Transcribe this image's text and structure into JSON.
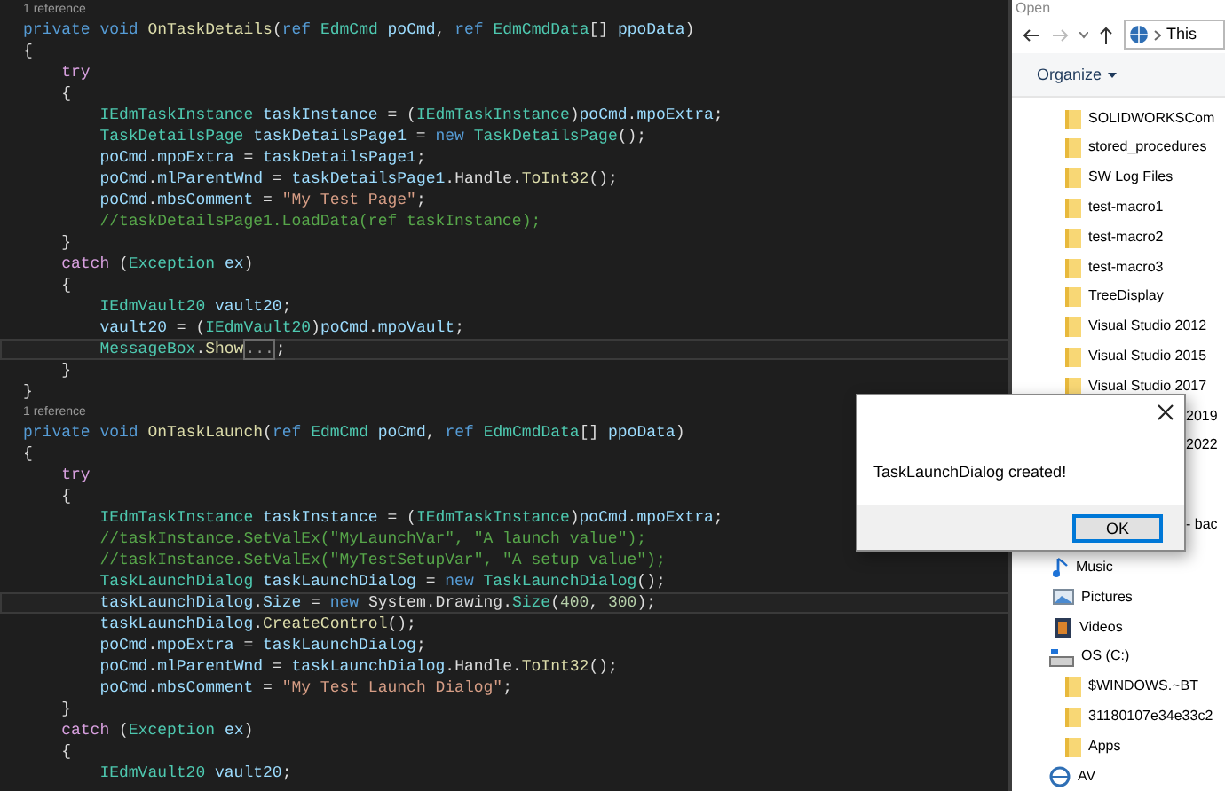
{
  "editor": {
    "lines": [
      {
        "kind": "reference",
        "text": "1 reference"
      },
      {
        "kind": "code",
        "highlighted": false,
        "tokens": [
          {
            "text": "private ",
            "kind": "keyword"
          },
          {
            "text": "void ",
            "kind": "keyword"
          },
          {
            "text": "OnTaskDetails",
            "kind": "method"
          },
          {
            "text": "(",
            "kind": "plain"
          },
          {
            "text": "ref ",
            "kind": "keyword"
          },
          {
            "text": "EdmCmd ",
            "kind": "type"
          },
          {
            "text": "poCmd",
            "kind": "variable"
          },
          {
            "text": ", ",
            "kind": "plain"
          },
          {
            "text": "ref ",
            "kind": "keyword"
          },
          {
            "text": "EdmCmdData",
            "kind": "type"
          },
          {
            "text": "[] ",
            "kind": "plain"
          },
          {
            "text": "ppoData",
            "kind": "variable"
          },
          {
            "text": ")",
            "kind": "plain"
          }
        ]
      },
      {
        "kind": "code",
        "highlighted": false,
        "tokens": [
          {
            "text": "{",
            "kind": "plain"
          }
        ]
      },
      {
        "kind": "code",
        "highlighted": false,
        "tokens": [
          {
            "text": "    try",
            "kind": "control"
          }
        ]
      },
      {
        "kind": "code",
        "highlighted": false,
        "tokens": [
          {
            "text": "    {",
            "kind": "plain"
          }
        ]
      },
      {
        "kind": "code",
        "highlighted": false,
        "tokens": [
          {
            "text": "        IEdmTaskInstance ",
            "kind": "type"
          },
          {
            "text": "taskInstance",
            "kind": "variable"
          },
          {
            "text": " = (",
            "kind": "plain"
          },
          {
            "text": "IEdmTaskInstance",
            "kind": "type"
          },
          {
            "text": ")",
            "kind": "plain"
          },
          {
            "text": "poCmd",
            "kind": "variable"
          },
          {
            "text": ".",
            "kind": "plain"
          },
          {
            "text": "mpoExtra",
            "kind": "variable"
          },
          {
            "text": ";",
            "kind": "plain"
          }
        ]
      },
      {
        "kind": "code",
        "highlighted": false,
        "tokens": [
          {
            "text": "        TaskDetailsPage ",
            "kind": "type"
          },
          {
            "text": "taskDetailsPage1",
            "kind": "variable"
          },
          {
            "text": " = ",
            "kind": "plain"
          },
          {
            "text": "new ",
            "kind": "keyword"
          },
          {
            "text": "TaskDetailsPage",
            "kind": "type"
          },
          {
            "text": "();",
            "kind": "plain"
          }
        ]
      },
      {
        "kind": "code",
        "highlighted": false,
        "tokens": [
          {
            "text": "        poCmd",
            "kind": "variable"
          },
          {
            "text": ".",
            "kind": "plain"
          },
          {
            "text": "mpoExtra",
            "kind": "variable"
          },
          {
            "text": " = ",
            "kind": "plain"
          },
          {
            "text": "taskDetailsPage1",
            "kind": "variable"
          },
          {
            "text": ";",
            "kind": "plain"
          }
        ]
      },
      {
        "kind": "code",
        "highlighted": false,
        "tokens": [
          {
            "text": "        poCmd",
            "kind": "variable"
          },
          {
            "text": ".",
            "kind": "plain"
          },
          {
            "text": "mlParentWnd",
            "kind": "variable"
          },
          {
            "text": " = ",
            "kind": "plain"
          },
          {
            "text": "taskDetailsPage1",
            "kind": "variable"
          },
          {
            "text": ".",
            "kind": "plain"
          },
          {
            "text": "Handle",
            "kind": "plain"
          },
          {
            "text": ".",
            "kind": "plain"
          },
          {
            "text": "ToInt32",
            "kind": "method"
          },
          {
            "text": "();",
            "kind": "plain"
          }
        ]
      },
      {
        "kind": "code",
        "highlighted": false,
        "tokens": [
          {
            "text": "        poCmd",
            "kind": "variable"
          },
          {
            "text": ".",
            "kind": "plain"
          },
          {
            "text": "mbsComment",
            "kind": "variable"
          },
          {
            "text": " = ",
            "kind": "plain"
          },
          {
            "text": "\"My Test Page\"",
            "kind": "string"
          },
          {
            "text": ";",
            "kind": "plain"
          }
        ]
      },
      {
        "kind": "code",
        "highlighted": false,
        "tokens": [
          {
            "text": "        //taskDetailsPage1.LoadData(ref taskInstance);",
            "kind": "comment"
          }
        ]
      },
      {
        "kind": "code",
        "highlighted": false,
        "tokens": [
          {
            "text": "    }",
            "kind": "plain"
          }
        ]
      },
      {
        "kind": "code",
        "highlighted": false,
        "tokens": [
          {
            "text": "    catch",
            "kind": "control"
          },
          {
            "text": " (",
            "kind": "plain"
          },
          {
            "text": "Exception ",
            "kind": "type"
          },
          {
            "text": "ex",
            "kind": "variable"
          },
          {
            "text": ")",
            "kind": "plain"
          }
        ]
      },
      {
        "kind": "code",
        "highlighted": false,
        "tokens": [
          {
            "text": "    {",
            "kind": "plain"
          }
        ]
      },
      {
        "kind": "code",
        "highlighted": false,
        "tokens": [
          {
            "text": "        IEdmVault20 ",
            "kind": "type"
          },
          {
            "text": "vault20",
            "kind": "variable"
          },
          {
            "text": ";",
            "kind": "plain"
          }
        ]
      },
      {
        "kind": "code",
        "highlighted": false,
        "tokens": [
          {
            "text": "        vault20",
            "kind": "variable"
          },
          {
            "text": " = (",
            "kind": "plain"
          },
          {
            "text": "IEdmVault20",
            "kind": "type"
          },
          {
            "text": ")",
            "kind": "plain"
          },
          {
            "text": "poCmd",
            "kind": "variable"
          },
          {
            "text": ".",
            "kind": "plain"
          },
          {
            "text": "mpoVault",
            "kind": "variable"
          },
          {
            "text": ";",
            "kind": "plain"
          }
        ]
      },
      {
        "kind": "code",
        "highlighted": true,
        "tokens": [
          {
            "text": "        MessageBox",
            "kind": "type"
          },
          {
            "text": ".",
            "kind": "plain"
          },
          {
            "text": "Show",
            "kind": "method"
          },
          {
            "text": "...",
            "kind": "collapsed"
          },
          {
            "text": ";",
            "kind": "plain"
          }
        ]
      },
      {
        "kind": "code",
        "highlighted": false,
        "tokens": [
          {
            "text": "    }",
            "kind": "plain"
          }
        ]
      },
      {
        "kind": "code",
        "highlighted": false,
        "tokens": [
          {
            "text": "}",
            "kind": "plain"
          }
        ]
      },
      {
        "kind": "reference",
        "text": "1 reference"
      },
      {
        "kind": "code",
        "highlighted": false,
        "tokens": [
          {
            "text": "private ",
            "kind": "keyword"
          },
          {
            "text": "void ",
            "kind": "keyword"
          },
          {
            "text": "OnTaskLaunch",
            "kind": "method"
          },
          {
            "text": "(",
            "kind": "plain"
          },
          {
            "text": "ref ",
            "kind": "keyword"
          },
          {
            "text": "EdmCmd ",
            "kind": "type"
          },
          {
            "text": "poCmd",
            "kind": "variable"
          },
          {
            "text": ", ",
            "kind": "plain"
          },
          {
            "text": "ref ",
            "kind": "keyword"
          },
          {
            "text": "EdmCmdData",
            "kind": "type"
          },
          {
            "text": "[] ",
            "kind": "plain"
          },
          {
            "text": "ppoData",
            "kind": "variable"
          },
          {
            "text": ")",
            "kind": "plain"
          }
        ]
      },
      {
        "kind": "code",
        "highlighted": false,
        "tokens": [
          {
            "text": "{",
            "kind": "plain"
          }
        ]
      },
      {
        "kind": "code",
        "highlighted": false,
        "tokens": [
          {
            "text": "    try",
            "kind": "control"
          }
        ]
      },
      {
        "kind": "code",
        "highlighted": false,
        "tokens": [
          {
            "text": "    {",
            "kind": "plain"
          }
        ]
      },
      {
        "kind": "code",
        "highlighted": false,
        "tokens": [
          {
            "text": "        IEdmTaskInstance ",
            "kind": "type"
          },
          {
            "text": "taskInstance",
            "kind": "variable"
          },
          {
            "text": " = (",
            "kind": "plain"
          },
          {
            "text": "IEdmTaskInstance",
            "kind": "type"
          },
          {
            "text": ")",
            "kind": "plain"
          },
          {
            "text": "poCmd",
            "kind": "variable"
          },
          {
            "text": ".",
            "kind": "plain"
          },
          {
            "text": "mpoExtra",
            "kind": "variable"
          },
          {
            "text": ";",
            "kind": "plain"
          }
        ]
      },
      {
        "kind": "code",
        "highlighted": false,
        "tokens": [
          {
            "text": "        //taskInstance.SetValEx(\"MyLaunchVar\", \"A launch value\");",
            "kind": "comment"
          }
        ]
      },
      {
        "kind": "code",
        "highlighted": false,
        "tokens": [
          {
            "text": "        //taskInstance.SetValEx(\"MyTestSetupVar\", \"A setup value\");",
            "kind": "comment"
          }
        ]
      },
      {
        "kind": "code",
        "highlighted": false,
        "tokens": [
          {
            "text": "        TaskLaunchDialog ",
            "kind": "type"
          },
          {
            "text": "taskLaunchDialog",
            "kind": "variable"
          },
          {
            "text": " = ",
            "kind": "plain"
          },
          {
            "text": "new ",
            "kind": "keyword"
          },
          {
            "text": "TaskLaunchDialog",
            "kind": "type"
          },
          {
            "text": "();",
            "kind": "plain"
          }
        ]
      },
      {
        "kind": "code",
        "highlighted": true,
        "tokens": [
          {
            "text": "        taskLaunchDialog",
            "kind": "variable"
          },
          {
            "text": ".",
            "kind": "plain"
          },
          {
            "text": "Size",
            "kind": "variable"
          },
          {
            "text": " = ",
            "kind": "plain"
          },
          {
            "text": "new ",
            "kind": "keyword"
          },
          {
            "text": "System",
            "kind": "plain"
          },
          {
            "text": ".",
            "kind": "plain"
          },
          {
            "text": "Drawing",
            "kind": "plain"
          },
          {
            "text": ".",
            "kind": "plain"
          },
          {
            "text": "Size",
            "kind": "type"
          },
          {
            "text": "(",
            "kind": "plain"
          },
          {
            "text": "400",
            "kind": "number"
          },
          {
            "text": ", ",
            "kind": "plain"
          },
          {
            "text": "300",
            "kind": "number"
          },
          {
            "text": ");",
            "kind": "plain"
          }
        ]
      },
      {
        "kind": "code",
        "highlighted": false,
        "tokens": [
          {
            "text": "        taskLaunchDialog",
            "kind": "variable"
          },
          {
            "text": ".",
            "kind": "plain"
          },
          {
            "text": "CreateControl",
            "kind": "method"
          },
          {
            "text": "();",
            "kind": "plain"
          }
        ]
      },
      {
        "kind": "code",
        "highlighted": false,
        "tokens": [
          {
            "text": "        poCmd",
            "kind": "variable"
          },
          {
            "text": ".",
            "kind": "plain"
          },
          {
            "text": "mpoExtra",
            "kind": "variable"
          },
          {
            "text": " = ",
            "kind": "plain"
          },
          {
            "text": "taskLaunchDialog",
            "kind": "variable"
          },
          {
            "text": ";",
            "kind": "plain"
          }
        ]
      },
      {
        "kind": "code",
        "highlighted": false,
        "tokens": [
          {
            "text": "        poCmd",
            "kind": "variable"
          },
          {
            "text": ".",
            "kind": "plain"
          },
          {
            "text": "mlParentWnd",
            "kind": "variable"
          },
          {
            "text": " = ",
            "kind": "plain"
          },
          {
            "text": "taskLaunchDialog",
            "kind": "variable"
          },
          {
            "text": ".",
            "kind": "plain"
          },
          {
            "text": "Handle",
            "kind": "plain"
          },
          {
            "text": ".",
            "kind": "plain"
          },
          {
            "text": "ToInt32",
            "kind": "method"
          },
          {
            "text": "();",
            "kind": "plain"
          }
        ]
      },
      {
        "kind": "code",
        "highlighted": false,
        "tokens": [
          {
            "text": "        poCmd",
            "kind": "variable"
          },
          {
            "text": ".",
            "kind": "plain"
          },
          {
            "text": "mbsComment",
            "kind": "variable"
          },
          {
            "text": " = ",
            "kind": "plain"
          },
          {
            "text": "\"My Test Launch Dialog\"",
            "kind": "string"
          },
          {
            "text": ";",
            "kind": "plain"
          }
        ]
      },
      {
        "kind": "code",
        "highlighted": false,
        "tokens": [
          {
            "text": "    }",
            "kind": "plain"
          }
        ]
      },
      {
        "kind": "code",
        "highlighted": false,
        "tokens": [
          {
            "text": "    catch",
            "kind": "control"
          },
          {
            "text": " (",
            "kind": "plain"
          },
          {
            "text": "Exception ",
            "kind": "type"
          },
          {
            "text": "ex",
            "kind": "variable"
          },
          {
            "text": ")",
            "kind": "plain"
          }
        ]
      },
      {
        "kind": "code",
        "highlighted": false,
        "tokens": [
          {
            "text": "    {",
            "kind": "plain"
          }
        ]
      },
      {
        "kind": "code",
        "highlighted": false,
        "tokens": [
          {
            "text": "        IEdmVault20 ",
            "kind": "type"
          },
          {
            "text": "vault20",
            "kind": "variable"
          },
          {
            "text": ";",
            "kind": "plain"
          }
        ]
      }
    ]
  },
  "file_dialog": {
    "title": "Open",
    "address": "This",
    "organize": "Organize",
    "items": [
      {
        "kind": "folder",
        "label": "SOLIDWORKSCom"
      },
      {
        "kind": "folder",
        "label": "stored_procedures"
      },
      {
        "kind": "folder",
        "label": "SW Log Files"
      },
      {
        "kind": "folder",
        "label": "test-macro1"
      },
      {
        "kind": "folder",
        "label": "test-macro2"
      },
      {
        "kind": "folder",
        "label": "test-macro3"
      },
      {
        "kind": "folder",
        "label": "TreeDisplay"
      },
      {
        "kind": "folder",
        "label": "Visual Studio 2012"
      },
      {
        "kind": "folder",
        "label": "Visual Studio 2015"
      },
      {
        "kind": "folder",
        "label": "Visual Studio 2017"
      },
      {
        "kind": "partial",
        "label": "2019"
      },
      {
        "kind": "partial",
        "label": "2022"
      },
      {
        "kind": "partial",
        "label": "- bac"
      },
      {
        "kind": "music",
        "label": "Music"
      },
      {
        "kind": "pictures",
        "label": "Pictures"
      },
      {
        "kind": "videos",
        "label": "Videos"
      },
      {
        "kind": "drive",
        "label": "OS (C:)"
      },
      {
        "kind": "subfolder",
        "label": "$WINDOWS.~BT"
      },
      {
        "kind": "subfolder",
        "label": "31180107e34e33c2"
      },
      {
        "kind": "subfolder",
        "label": "Apps"
      },
      {
        "kind": "network",
        "label": "AV"
      }
    ]
  },
  "message_box": {
    "message": "TaskLaunchDialog created!",
    "button": "OK"
  }
}
